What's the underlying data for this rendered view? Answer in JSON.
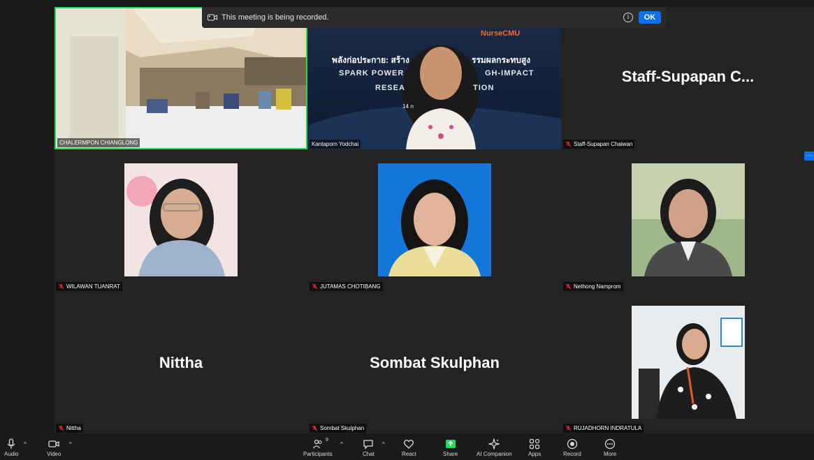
{
  "banner": {
    "text": "This meeting is being recorded.",
    "info_glyph": "i",
    "ok_label": "OK"
  },
  "side_more_glyph": "···",
  "tiles": [
    {
      "name": "CHALERMPON CHIANGLONG",
      "type": "video",
      "muted": false
    },
    {
      "name": "Kantaporn Yodchai",
      "type": "video",
      "muted": false
    },
    {
      "name": "Staff-Supapan Chaiwan",
      "type": "name",
      "display_name": "Staff-Supapan  C...",
      "muted": true
    },
    {
      "name": "WILAWAN TUANRAT",
      "type": "photo",
      "muted": true
    },
    {
      "name": "JUTAMAS CHOTIBANG",
      "type": "photo",
      "muted": true
    },
    {
      "name": "Nethong Namprom",
      "type": "photo",
      "muted": true
    },
    {
      "name": "Nittha",
      "type": "name",
      "display_name": "Nittha",
      "muted": true
    },
    {
      "name": "Sombat Skulphan",
      "type": "name",
      "display_name": "Sombat Skulphan",
      "muted": true
    },
    {
      "name": "RUJADHORN INDRATULA",
      "type": "photo",
      "muted": true
    }
  ],
  "slide": {
    "brand": "NurseCMU",
    "line1": "พลังก่อประกาย: สร้าง",
    "line1b": "รรมผลกระทบสูง",
    "line2a": "SPARK POWER",
    "line2b": "GH-IMPACT",
    "line3a": "RESEA",
    "line3b": "TION",
    "date": "14 ก"
  },
  "toolbar": {
    "audio": "Audio",
    "video": "Video",
    "participants": "Participants",
    "participants_count": "9",
    "chat": "Chat",
    "react": "React",
    "share": "Share",
    "ai_companion": "AI Companion",
    "apps": "Apps",
    "record": "Record",
    "more": "More",
    "caret": "^"
  },
  "colors": {
    "accent": "#0e71eb",
    "share_green": "#23d959",
    "mute_red": "#e02828",
    "active_speaker": "#23d959"
  }
}
